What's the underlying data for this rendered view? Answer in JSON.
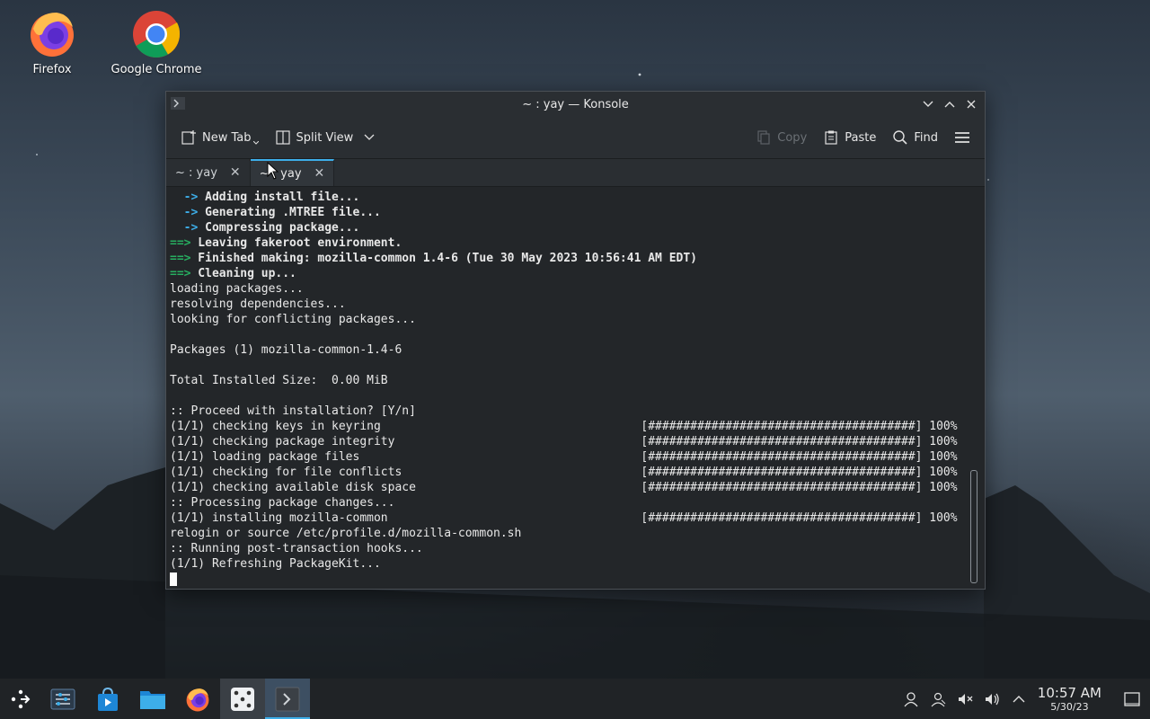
{
  "desktop": {
    "icons": [
      {
        "label": "Firefox",
        "icon": "firefox-icon"
      },
      {
        "label": "Google Chrome",
        "icon": "chrome-icon"
      }
    ]
  },
  "window": {
    "title": "~ : yay — Konsole",
    "toolbar": {
      "new_tab": "New Tab",
      "split_view": "Split View",
      "copy": "Copy",
      "paste": "Paste",
      "find": "Find"
    },
    "tabs": [
      {
        "label": "~ : yay",
        "active": false
      },
      {
        "label": "~ : yay",
        "active": true
      }
    ]
  },
  "terminal": {
    "lines": [
      {
        "text": "  -> Adding install file...",
        "style": "arrow"
      },
      {
        "text": "  -> Generating .MTREE file...",
        "style": "arrow"
      },
      {
        "text": "  -> Compressing package...",
        "style": "arrow"
      },
      {
        "text": "==> Leaving fakeroot environment.",
        "style": "green"
      },
      {
        "text": "==> Finished making: mozilla-common 1.4-6 (Tue 30 May 2023 10:56:41 AM EDT)",
        "style": "green"
      },
      {
        "text": "==> Cleaning up...",
        "style": "green"
      },
      {
        "text": "loading packages...",
        "style": "plain"
      },
      {
        "text": "resolving dependencies...",
        "style": "plain"
      },
      {
        "text": "looking for conflicting packages...",
        "style": "plain"
      },
      {
        "text": "",
        "style": "plain"
      },
      {
        "text": "Packages (1) mozilla-common-1.4-6",
        "style": "plain"
      },
      {
        "text": "",
        "style": "plain"
      },
      {
        "text": "Total Installed Size:  0.00 MiB",
        "style": "plain"
      },
      {
        "text": "",
        "style": "plain"
      },
      {
        "text": ":: Proceed with installation? [Y/n]",
        "style": "plain"
      },
      {
        "text": "(1/1) checking keys in keyring                                     [######################################] 100%",
        "style": "plain"
      },
      {
        "text": "(1/1) checking package integrity                                   [######################################] 100%",
        "style": "plain"
      },
      {
        "text": "(1/1) loading package files                                        [######################################] 100%",
        "style": "plain"
      },
      {
        "text": "(1/1) checking for file conflicts                                  [######################################] 100%",
        "style": "plain"
      },
      {
        "text": "(1/1) checking available disk space                                [######################################] 100%",
        "style": "plain"
      },
      {
        "text": ":: Processing package changes...",
        "style": "plain"
      },
      {
        "text": "(1/1) installing mozilla-common                                    [######################################] 100%",
        "style": "plain"
      },
      {
        "text": "relogin or source /etc/profile.d/mozilla-common.sh",
        "style": "plain"
      },
      {
        "text": ":: Running post-transaction hooks...",
        "style": "plain"
      },
      {
        "text": "(1/1) Refreshing PackageKit...",
        "style": "plain"
      }
    ]
  },
  "taskbar": {
    "items": [
      "app-launcher-icon",
      "overview-icon",
      "discover-icon",
      "files-icon",
      "firefox-icon",
      "dice-icon",
      "konsole-icon"
    ],
    "clock": {
      "time": "10:57 AM",
      "date": "5/30/23"
    }
  }
}
